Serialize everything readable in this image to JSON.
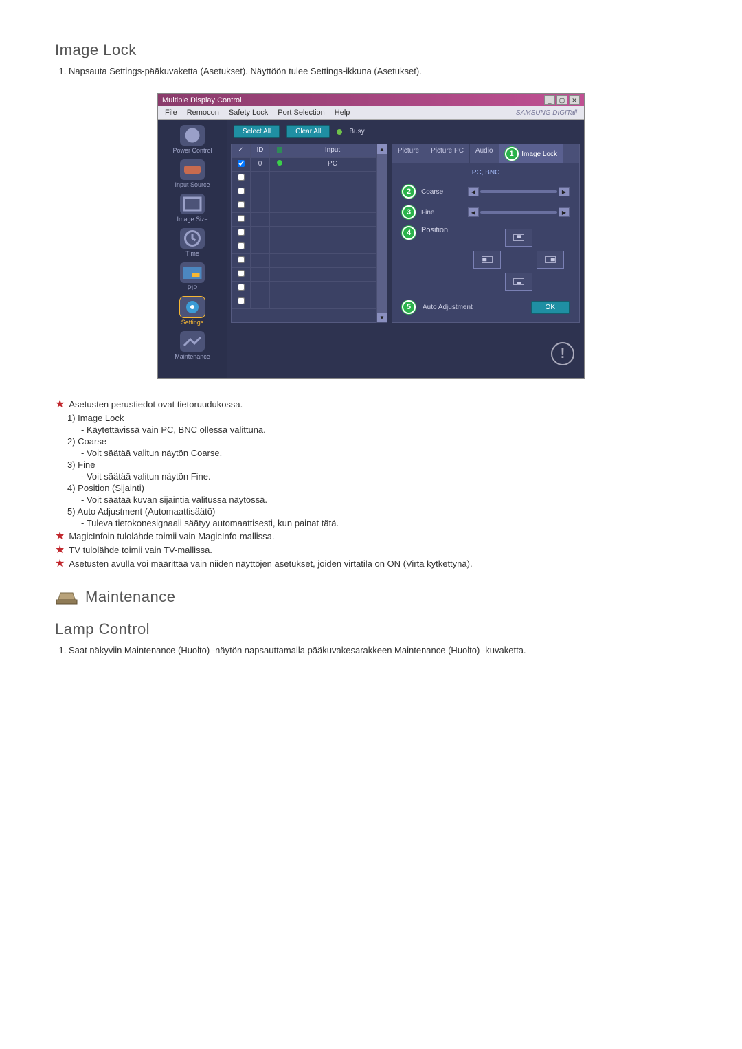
{
  "section1_title": "Image Lock",
  "section1_step1": "Napsauta Settings-pääkuvaketta (Asetukset). Näyttöön tulee Settings-ikkuna (Asetukset).",
  "window_title": "Multiple Display Control",
  "menu": {
    "file": "File",
    "remocon": "Remocon",
    "safety": "Safety Lock",
    "port": "Port Selection",
    "help": "Help"
  },
  "brand": "SAMSUNG DIGITall",
  "topbar": {
    "select_all": "Select All",
    "clear_all": "Clear All",
    "busy": "Busy"
  },
  "sidebar": {
    "power": "Power Control",
    "input": "Input Source",
    "image_size": "Image Size",
    "time": "Time",
    "pip": "PIP",
    "settings": "Settings",
    "maintenance": "Maintenance"
  },
  "table": {
    "col_check": "✓",
    "col_id": "ID",
    "col_status": "",
    "col_input": "Input",
    "row0": {
      "id": "0",
      "input": "PC"
    }
  },
  "tabs": {
    "picture": "Picture",
    "picture_pc": "Picture PC",
    "audio": "Audio",
    "image_lock": "Image Lock"
  },
  "panel": {
    "subtitle": "PC, BNC",
    "coarse": "Coarse",
    "fine": "Fine",
    "position": "Position",
    "auto_adjust": "Auto Adjustment",
    "ok": "OK"
  },
  "callouts": {
    "c1": "1",
    "c2": "2",
    "c3": "3",
    "c4": "4",
    "c5": "5"
  },
  "bullets": {
    "intro": "Asetusten perustiedot ovat tietoruudukossa.",
    "l1_head": "1)  Image Lock",
    "l1_sub": "- Käytettävissä vain PC, BNC ollessa valittuna.",
    "l2_head": "2)  Coarse",
    "l2_sub": "- Voit säätää valitun näytön Coarse.",
    "l3_head": "3)  Fine",
    "l3_sub": "- Voit säätää valitun näytön Fine.",
    "l4_head": "4)  Position (Sijainti)",
    "l4_sub": "- Voit säätää kuvan sijaintia valitussa näytössä.",
    "l5_head": "5)  Auto Adjustment (Automaattisäätö)",
    "l5_sub": "- Tuleva tietokonesignaali säätyy automaattisesti, kun painat tätä.",
    "note1": "MagicInfoin tulolähde toimii vain MagicInfo-mallissa.",
    "note2": "TV tulolähde toimii vain TV-mallissa.",
    "note3": "Asetusten avulla voi määrittää vain niiden näyttöjen asetukset, joiden virtatila on ON (Virta kytkettynä)."
  },
  "section2_title": "Maintenance",
  "section3_title": "Lamp Control",
  "section3_step1": "Saat näkyviin Maintenance (Huolto) -näytön napsauttamalla pääkuvakesarakkeen Maintenance (Huolto) -kuvaketta."
}
